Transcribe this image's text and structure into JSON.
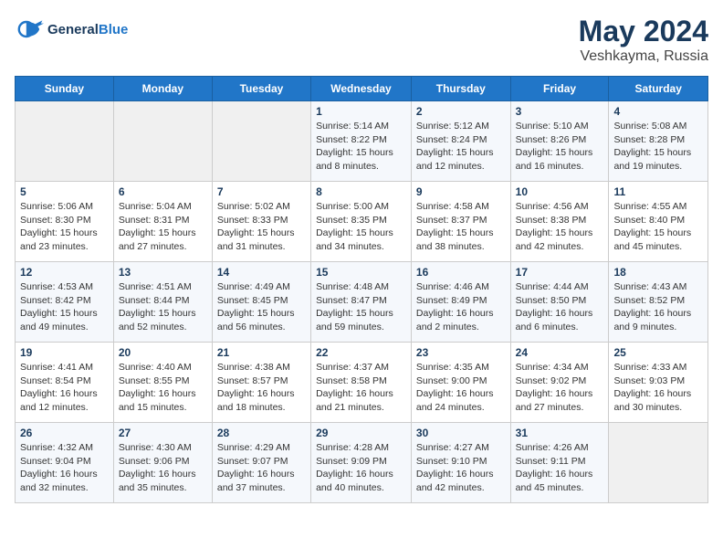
{
  "header": {
    "logo_line1": "General",
    "logo_line2": "Blue",
    "month_year": "May 2024",
    "location": "Veshkayma, Russia"
  },
  "weekdays": [
    "Sunday",
    "Monday",
    "Tuesday",
    "Wednesday",
    "Thursday",
    "Friday",
    "Saturday"
  ],
  "weeks": [
    [
      {
        "day": "",
        "info": ""
      },
      {
        "day": "",
        "info": ""
      },
      {
        "day": "",
        "info": ""
      },
      {
        "day": "1",
        "info": "Sunrise: 5:14 AM\nSunset: 8:22 PM\nDaylight: 15 hours\nand 8 minutes."
      },
      {
        "day": "2",
        "info": "Sunrise: 5:12 AM\nSunset: 8:24 PM\nDaylight: 15 hours\nand 12 minutes."
      },
      {
        "day": "3",
        "info": "Sunrise: 5:10 AM\nSunset: 8:26 PM\nDaylight: 15 hours\nand 16 minutes."
      },
      {
        "day": "4",
        "info": "Sunrise: 5:08 AM\nSunset: 8:28 PM\nDaylight: 15 hours\nand 19 minutes."
      }
    ],
    [
      {
        "day": "5",
        "info": "Sunrise: 5:06 AM\nSunset: 8:30 PM\nDaylight: 15 hours\nand 23 minutes."
      },
      {
        "day": "6",
        "info": "Sunrise: 5:04 AM\nSunset: 8:31 PM\nDaylight: 15 hours\nand 27 minutes."
      },
      {
        "day": "7",
        "info": "Sunrise: 5:02 AM\nSunset: 8:33 PM\nDaylight: 15 hours\nand 31 minutes."
      },
      {
        "day": "8",
        "info": "Sunrise: 5:00 AM\nSunset: 8:35 PM\nDaylight: 15 hours\nand 34 minutes."
      },
      {
        "day": "9",
        "info": "Sunrise: 4:58 AM\nSunset: 8:37 PM\nDaylight: 15 hours\nand 38 minutes."
      },
      {
        "day": "10",
        "info": "Sunrise: 4:56 AM\nSunset: 8:38 PM\nDaylight: 15 hours\nand 42 minutes."
      },
      {
        "day": "11",
        "info": "Sunrise: 4:55 AM\nSunset: 8:40 PM\nDaylight: 15 hours\nand 45 minutes."
      }
    ],
    [
      {
        "day": "12",
        "info": "Sunrise: 4:53 AM\nSunset: 8:42 PM\nDaylight: 15 hours\nand 49 minutes."
      },
      {
        "day": "13",
        "info": "Sunrise: 4:51 AM\nSunset: 8:44 PM\nDaylight: 15 hours\nand 52 minutes."
      },
      {
        "day": "14",
        "info": "Sunrise: 4:49 AM\nSunset: 8:45 PM\nDaylight: 15 hours\nand 56 minutes."
      },
      {
        "day": "15",
        "info": "Sunrise: 4:48 AM\nSunset: 8:47 PM\nDaylight: 15 hours\nand 59 minutes."
      },
      {
        "day": "16",
        "info": "Sunrise: 4:46 AM\nSunset: 8:49 PM\nDaylight: 16 hours\nand 2 minutes."
      },
      {
        "day": "17",
        "info": "Sunrise: 4:44 AM\nSunset: 8:50 PM\nDaylight: 16 hours\nand 6 minutes."
      },
      {
        "day": "18",
        "info": "Sunrise: 4:43 AM\nSunset: 8:52 PM\nDaylight: 16 hours\nand 9 minutes."
      }
    ],
    [
      {
        "day": "19",
        "info": "Sunrise: 4:41 AM\nSunset: 8:54 PM\nDaylight: 16 hours\nand 12 minutes."
      },
      {
        "day": "20",
        "info": "Sunrise: 4:40 AM\nSunset: 8:55 PM\nDaylight: 16 hours\nand 15 minutes."
      },
      {
        "day": "21",
        "info": "Sunrise: 4:38 AM\nSunset: 8:57 PM\nDaylight: 16 hours\nand 18 minutes."
      },
      {
        "day": "22",
        "info": "Sunrise: 4:37 AM\nSunset: 8:58 PM\nDaylight: 16 hours\nand 21 minutes."
      },
      {
        "day": "23",
        "info": "Sunrise: 4:35 AM\nSunset: 9:00 PM\nDaylight: 16 hours\nand 24 minutes."
      },
      {
        "day": "24",
        "info": "Sunrise: 4:34 AM\nSunset: 9:02 PM\nDaylight: 16 hours\nand 27 minutes."
      },
      {
        "day": "25",
        "info": "Sunrise: 4:33 AM\nSunset: 9:03 PM\nDaylight: 16 hours\nand 30 minutes."
      }
    ],
    [
      {
        "day": "26",
        "info": "Sunrise: 4:32 AM\nSunset: 9:04 PM\nDaylight: 16 hours\nand 32 minutes."
      },
      {
        "day": "27",
        "info": "Sunrise: 4:30 AM\nSunset: 9:06 PM\nDaylight: 16 hours\nand 35 minutes."
      },
      {
        "day": "28",
        "info": "Sunrise: 4:29 AM\nSunset: 9:07 PM\nDaylight: 16 hours\nand 37 minutes."
      },
      {
        "day": "29",
        "info": "Sunrise: 4:28 AM\nSunset: 9:09 PM\nDaylight: 16 hours\nand 40 minutes."
      },
      {
        "day": "30",
        "info": "Sunrise: 4:27 AM\nSunset: 9:10 PM\nDaylight: 16 hours\nand 42 minutes."
      },
      {
        "day": "31",
        "info": "Sunrise: 4:26 AM\nSunset: 9:11 PM\nDaylight: 16 hours\nand 45 minutes."
      },
      {
        "day": "",
        "info": ""
      }
    ]
  ]
}
